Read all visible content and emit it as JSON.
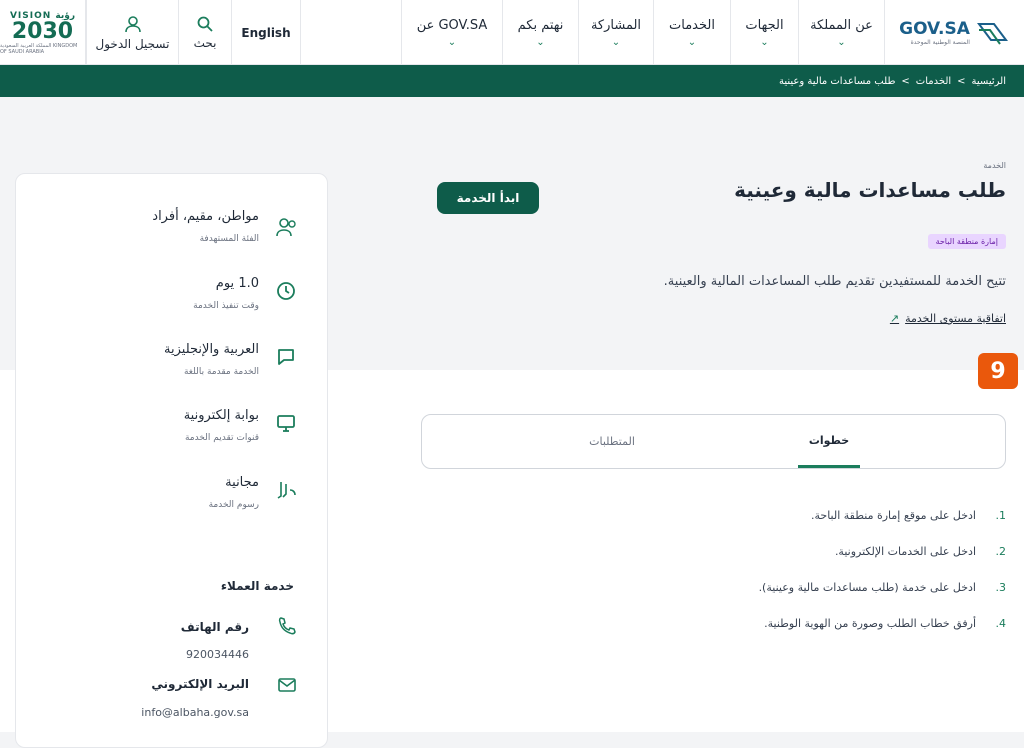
{
  "header": {
    "vision_top": "VISION رؤية",
    "vision_year": "2030",
    "vision_sub": "المملكة العربية السعودية KINGDOM OF SAUDI ARABIA",
    "login_label": "تسجيل الدخول",
    "search_label": "بحث",
    "language_label": "English",
    "nav": [
      "عن GOV.SA",
      "نهتم بكم",
      "المشاركة",
      "الخدمات",
      "الجهات",
      "عن المملكة"
    ],
    "logo_text": "GOV.SA",
    "logo_sub": "المنصة الوطنية الموحدة"
  },
  "breadcrumb": [
    "الرئيسية",
    ">",
    "الخدمات",
    ">",
    "طلب مساعدات مالية وعينية"
  ],
  "service": {
    "caption": "الخدمة",
    "title": "طلب مساعدات مالية وعينية",
    "start_button": "ابدأ الخدمة",
    "badge": "إمارة منطقة الباحة",
    "description": "تتيح الخدمة للمستفيدين تقديم طلب المساعدات المالية والعينية.",
    "sla_link": "اتفاقية مستوى الخدمة"
  },
  "tabs": {
    "steps": "خطوات",
    "requirements": "المتطلبات"
  },
  "steps": [
    {
      "num": "1.",
      "text": "ادخل على موقع إمارة منطقة الباحة."
    },
    {
      "num": "2.",
      "text": "ادخل على الخدمات الإلكترونية."
    },
    {
      "num": "3.",
      "text": "ادخل على خدمة (طلب مساعدات مالية وعينية)."
    },
    {
      "num": "4.",
      "text": "أرفق خطاب الطلب وصورة من الهوية الوطنية."
    }
  ],
  "info": [
    {
      "value": "مواطن، مقيم، أفراد",
      "label": "الفئة المستهدفة",
      "icon": "users-icon"
    },
    {
      "value": "1.0 يوم",
      "label": "وقت تنفيذ الخدمة",
      "icon": "clock-icon"
    },
    {
      "value": "العربية والإنجليزية",
      "label": "الخدمة مقدمة باللغة",
      "icon": "chat-icon"
    },
    {
      "value": "بوابة إلكترونية",
      "label": "قنوات تقديم الخدمة",
      "icon": "monitor-icon"
    },
    {
      "value": "مجانية",
      "label": "رسوم الخدمة",
      "icon": "riyal-icon"
    }
  ],
  "customer_service": {
    "title": "خدمة العملاء",
    "phone_label": "رقم الهاتف",
    "phone": "920034446",
    "email_label": "البريد الإلكتروني",
    "email": "info@albaha.gov.sa"
  },
  "colors": {
    "primary": "#0e5c4a",
    "accent": "#1b7d5c",
    "badge": "#e9d5ff"
  }
}
